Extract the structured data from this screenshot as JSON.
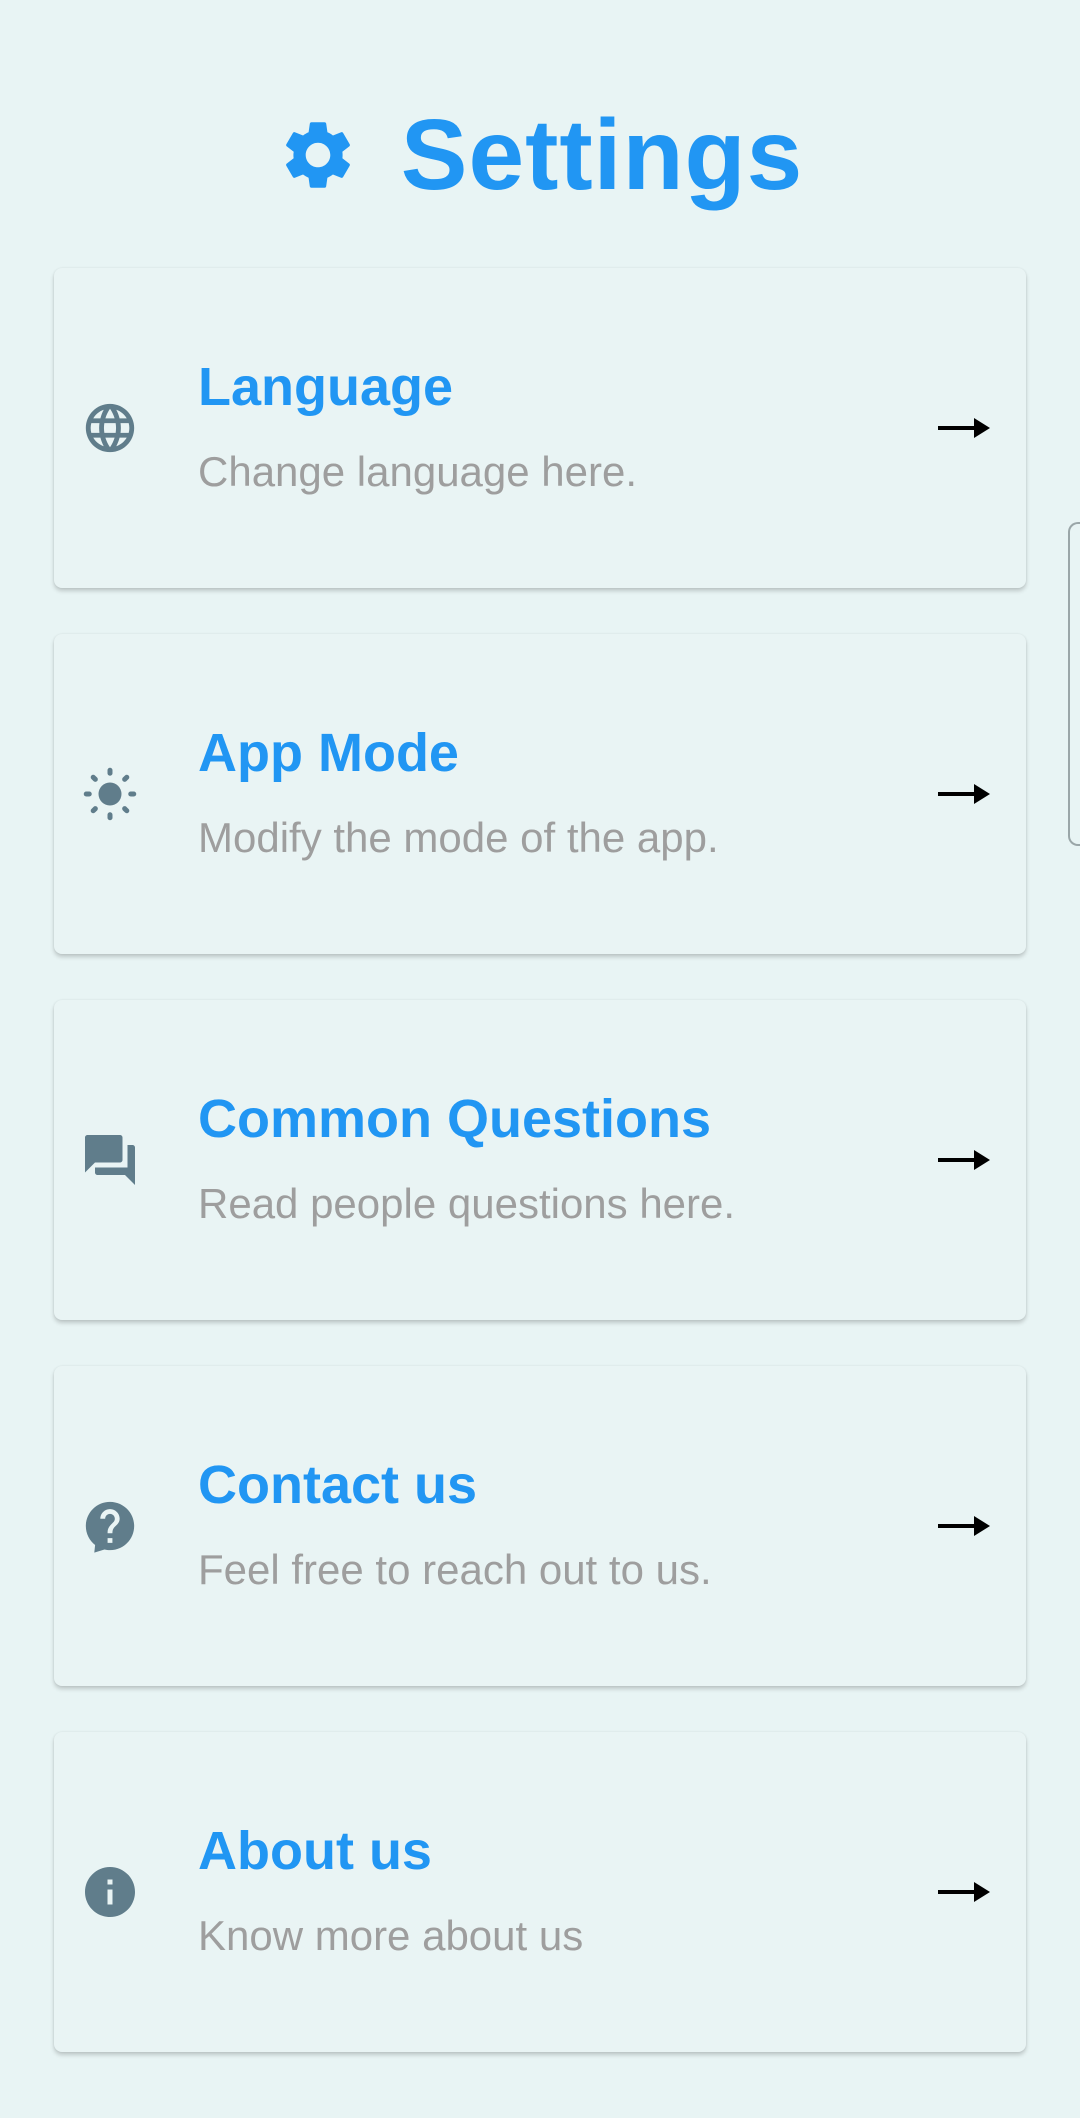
{
  "page": {
    "title": "Settings",
    "title_icon": "gear-icon",
    "accent_color": "#2196f3",
    "icon_color": "#607d8b",
    "subtitle_color": "#9e9e9e",
    "background_color": "#e8f4f4"
  },
  "items": [
    {
      "title": "Language",
      "subtitle": "Change language here.",
      "icon": "globe-icon",
      "arrow": "arrow-right-icon"
    },
    {
      "title": "App Mode",
      "subtitle": "Modify the mode of the app.",
      "icon": "brightness-icon",
      "arrow": "arrow-right-icon"
    },
    {
      "title": "Common Questions",
      "subtitle": "Read people questions here.",
      "icon": "forum-icon",
      "arrow": "arrow-right-icon"
    },
    {
      "title": "Contact us",
      "subtitle": "Feel free to reach out to us.",
      "icon": "help-icon",
      "arrow": "arrow-right-icon"
    },
    {
      "title": "About us",
      "subtitle": "Know more about us",
      "icon": "info-icon",
      "arrow": "arrow-right-icon"
    }
  ]
}
